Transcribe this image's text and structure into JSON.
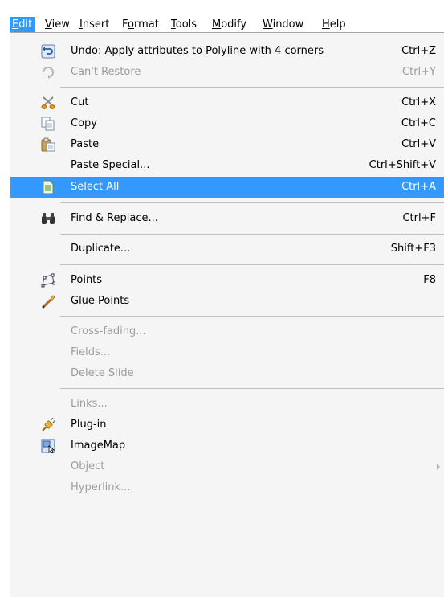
{
  "menubar": {
    "items": [
      {
        "label": "Edit",
        "access": "E",
        "active": true
      },
      {
        "label": "View",
        "access": "V"
      },
      {
        "label": "Insert",
        "access": "I"
      },
      {
        "label": "Format",
        "access": "o"
      },
      {
        "label": "Tools",
        "access": "T"
      },
      {
        "label": "Modify",
        "access": "M"
      },
      {
        "label": "Window",
        "access": "W"
      },
      {
        "label": "Help",
        "access": "H"
      }
    ]
  },
  "edit_menu": {
    "items": [
      {
        "label": "Undo: Apply attributes to Polyline with 4 corners",
        "shortcut": "Ctrl+Z",
        "icon": "undo-icon",
        "enabled": true
      },
      {
        "label": "Can't Restore",
        "shortcut": "Ctrl+Y",
        "icon": "redo-icon",
        "enabled": false
      },
      {
        "label": "Cut",
        "shortcut": "Ctrl+X",
        "icon": "scissors-icon",
        "enabled": true
      },
      {
        "label": "Copy",
        "shortcut": "Ctrl+C",
        "icon": "copy-icon",
        "enabled": true
      },
      {
        "label": "Paste",
        "shortcut": "Ctrl+V",
        "icon": "paste-icon",
        "enabled": true
      },
      {
        "label": "Paste Special...",
        "shortcut": "Ctrl+Shift+V",
        "enabled": true
      },
      {
        "label": "Select All",
        "shortcut": "Ctrl+A",
        "icon": "select-all-icon",
        "enabled": true,
        "highlighted": true
      },
      {
        "label": "Find & Replace...",
        "shortcut": "Ctrl+F",
        "icon": "binoculars-icon",
        "enabled": true
      },
      {
        "label": "Duplicate...",
        "shortcut": "Shift+F3",
        "enabled": true
      },
      {
        "label": "Points",
        "shortcut": "F8",
        "icon": "points-icon",
        "enabled": true
      },
      {
        "label": "Glue Points",
        "shortcut": "",
        "icon": "glue-points-icon",
        "enabled": true
      },
      {
        "label": "Cross-fading...",
        "shortcut": "",
        "enabled": false
      },
      {
        "label": "Fields...",
        "shortcut": "",
        "enabled": false
      },
      {
        "label": "Delete Slide",
        "shortcut": "",
        "enabled": false
      },
      {
        "label": "Links...",
        "shortcut": "",
        "enabled": false
      },
      {
        "label": "Plug-in",
        "shortcut": "",
        "icon": "plug-in-icon",
        "enabled": true
      },
      {
        "label": "ImageMap",
        "shortcut": "",
        "icon": "imagemap-icon",
        "enabled": true
      },
      {
        "label": "Object",
        "shortcut": "",
        "enabled": false,
        "submenu": true
      },
      {
        "label": "Hyperlink...",
        "shortcut": "",
        "enabled": false
      }
    ]
  },
  "colors": {
    "highlight": "#3399ff",
    "disabled_text": "#9c9c9c",
    "menu_background": "#f5f5f5"
  }
}
